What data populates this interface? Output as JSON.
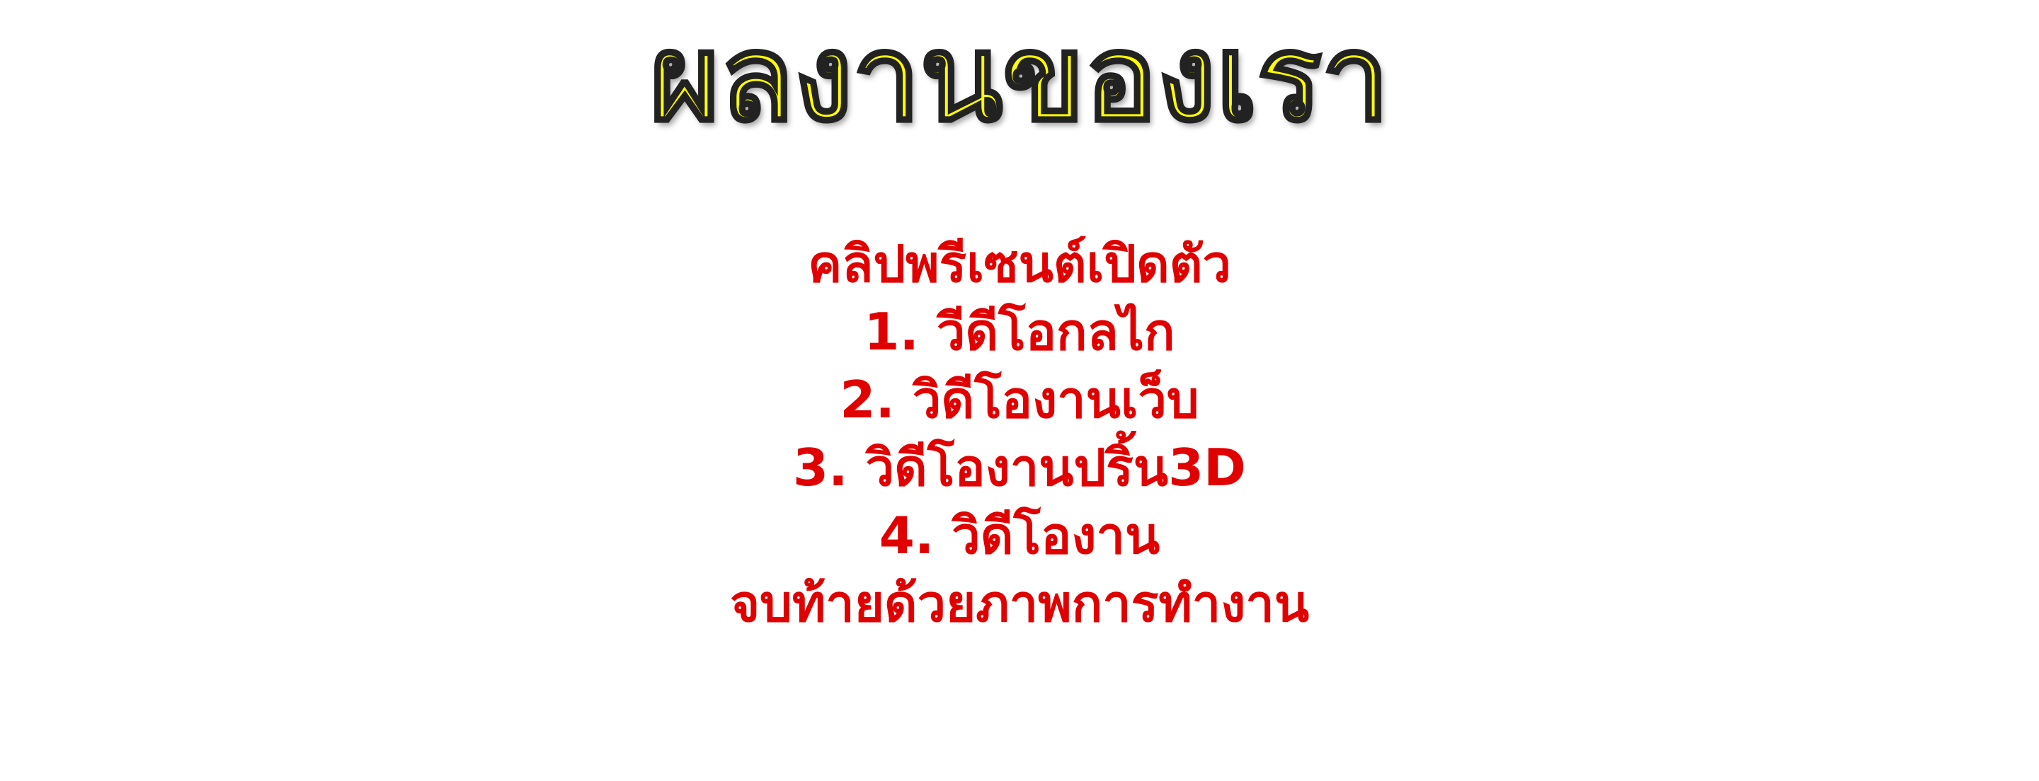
{
  "slide": {
    "title": "ผลงานของเรา",
    "lines": [
      "คลิปพรีเซนต์เปิดตัว",
      "1. วีดีโอกลไก",
      "2. วิดีโองานเว็บ",
      "3. วิดีโองานปริ้น3D",
      "4. วิดีโองาน",
      "จบท้ายด้วยภาพการทำงาน"
    ]
  },
  "colors": {
    "title_fill": "#ffff00",
    "title_outline": "#222222",
    "body_text": "#e00000",
    "background": "#ffffff"
  }
}
